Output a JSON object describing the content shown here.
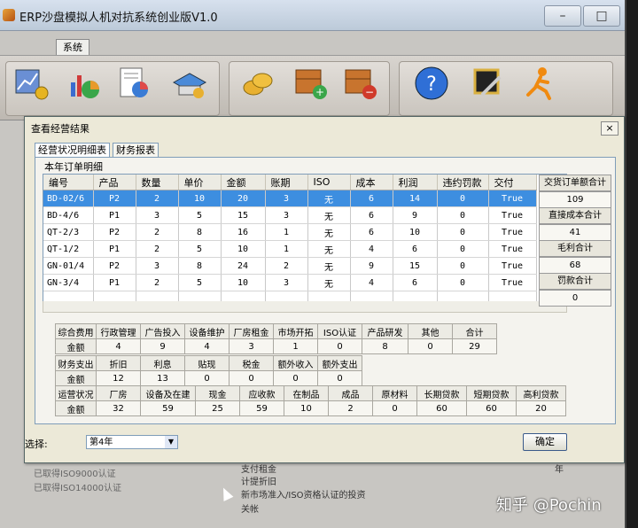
{
  "app": {
    "title": "ERP沙盘模拟人机对抗系统创业版V1.0",
    "menu_tab": "系统"
  },
  "toolbar_icons": [
    "chart-coins-icon",
    "pie-chart-icon",
    "report-pie-icon",
    "printer-icon",
    "coins-icon",
    "add-box-icon",
    "remove-box-icon",
    "help-icon",
    "tools-icon",
    "exit-runner-icon"
  ],
  "dialog": {
    "title": "查看经营结果",
    "close": "×",
    "tabs": [
      "经营状况明细表",
      "财务报表"
    ],
    "section_label": "本年订单明细",
    "order_headers": [
      "编号",
      "产品",
      "数量",
      "单价",
      "金额",
      "账期",
      "ISO",
      "成本",
      "利润",
      "违约罚款",
      "交付"
    ],
    "orders": [
      [
        "BD-02/6",
        "P2",
        "2",
        "10",
        "20",
        "3",
        "无",
        "6",
        "14",
        "0",
        "True"
      ],
      [
        "BD-4/6",
        "P1",
        "3",
        "5",
        "15",
        "3",
        "无",
        "6",
        "9",
        "0",
        "True"
      ],
      [
        "QT-2/3",
        "P2",
        "2",
        "8",
        "16",
        "1",
        "无",
        "6",
        "10",
        "0",
        "True"
      ],
      [
        "QT-1/2",
        "P1",
        "2",
        "5",
        "10",
        "1",
        "无",
        "4",
        "6",
        "0",
        "True"
      ],
      [
        "GN-01/4",
        "P2",
        "3",
        "8",
        "24",
        "2",
        "无",
        "9",
        "15",
        "0",
        "True"
      ],
      [
        "GN-3/4",
        "P1",
        "2",
        "5",
        "10",
        "3",
        "无",
        "4",
        "6",
        "0",
        "True"
      ]
    ],
    "totals": [
      {
        "label": "交货订单额合计",
        "value": "109"
      },
      {
        "label": "直接成本合计",
        "value": "41"
      },
      {
        "label": "毛利合计",
        "value": "68"
      },
      {
        "label": "罚款合计",
        "value": "0"
      }
    ],
    "expenses": {
      "headers": [
        "综合费用",
        "行政管理",
        "广告投入",
        "设备维护",
        "厂房租金",
        "市场开拓",
        "ISO认证",
        "产品研发",
        "其他",
        "合计"
      ],
      "row_label": "金额",
      "values": [
        "4",
        "9",
        "4",
        "3",
        "1",
        "0",
        "8",
        "0",
        "29"
      ]
    },
    "finance": {
      "headers": [
        "财务支出",
        "折旧",
        "利息",
        "贴现",
        "税金",
        "额外收入",
        "额外支出"
      ],
      "row_label": "金额",
      "values": [
        "12",
        "13",
        "0",
        "0",
        "0",
        "0"
      ]
    },
    "operations": {
      "headers": [
        "运营状况",
        "厂房",
        "设备及在建",
        "现金",
        "应收款",
        "在制品",
        "成品",
        "原材料",
        "长期贷款",
        "短期贷款",
        "高利贷款"
      ],
      "row_label": "金额",
      "values": [
        "32",
        "59",
        "25",
        "59",
        "10",
        "2",
        "0",
        "60",
        "60",
        "20"
      ]
    },
    "select_label": "选择:",
    "select_value": "第4年",
    "ok": "确定"
  },
  "background": {
    "left_1": "已取得ISO9000认证",
    "left_2": "已取得ISO14000认证",
    "mid_1": "支付租金",
    "mid_2": "计提折旧",
    "mid_3": "新市场准入/ISO资格认证的投资",
    "mid_4": "关帐",
    "right_1": "年"
  },
  "watermark": "知乎 @Pochin"
}
